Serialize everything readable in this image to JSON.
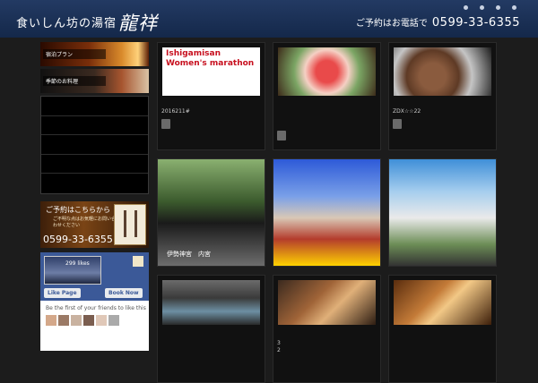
{
  "header": {
    "logo_prefix": "食いしん坊の湯宿",
    "logo_name": "龍祥",
    "phone_label": "ご予約はお電話で",
    "phone_number": "0599-33-6355"
  },
  "sidebar": {
    "banner_plan": "宿泊プラン",
    "banner_cuisine": "季節のお料理",
    "reserve_title": "ご予約はこちらから",
    "reserve_note": "ご不明な点はお気軽にお問い合わせください",
    "reserve_phone": "0599-33-6355",
    "fb_likes": "299 likes",
    "fb_like_page": "Like Page",
    "fb_book_now": "Book Now",
    "fb_friends_text": "Be the first of your friends to like this"
  },
  "grid": {
    "marathon_text": "Ishigamisan Women's marathon",
    "card1_caption": "2016211#",
    "card3_caption": "ZDX☆☆22",
    "shrine_caption": "伊勢神宮　内宮",
    "card8_caption": "3\n2"
  }
}
